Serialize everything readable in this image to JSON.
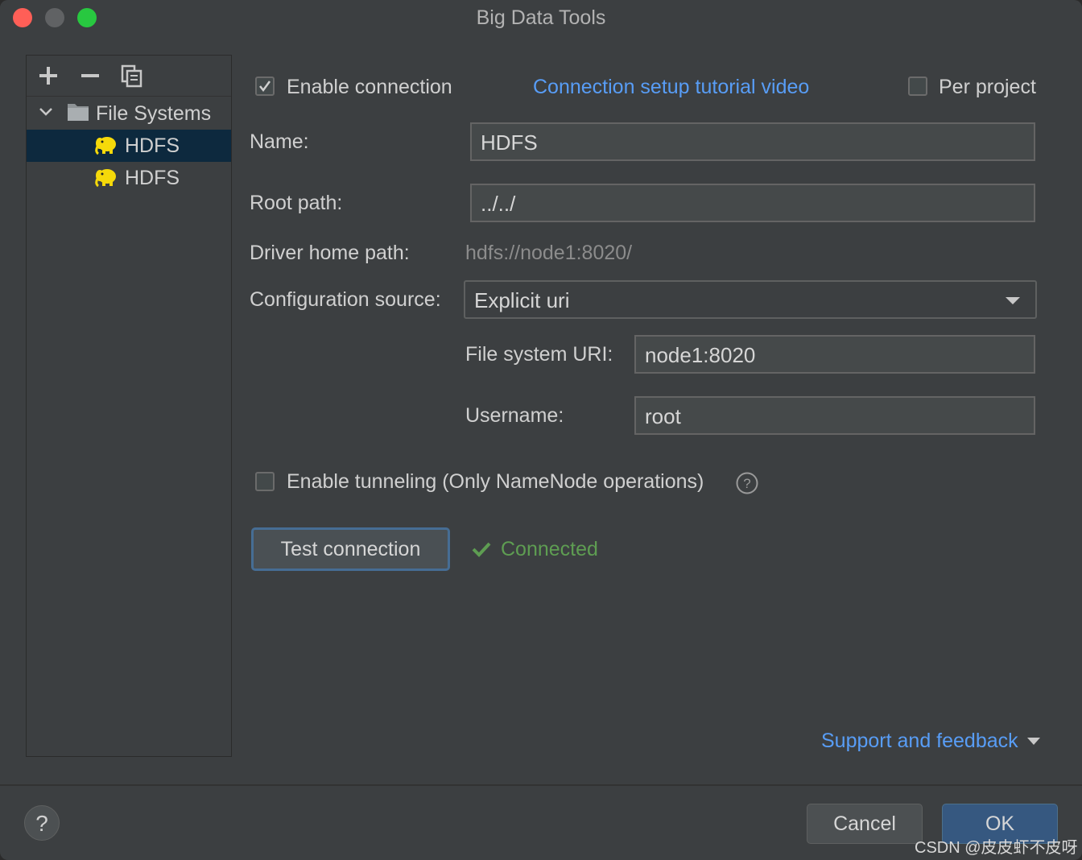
{
  "window": {
    "title": "Big Data Tools"
  },
  "sidebar": {
    "toolbar": {
      "add": "+",
      "remove": "−"
    },
    "tree": {
      "group_label": "File Systems",
      "items": [
        {
          "label": "HDFS",
          "selected": true
        },
        {
          "label": "HDFS",
          "selected": false
        }
      ]
    }
  },
  "form": {
    "enable_connection": {
      "label": "Enable connection",
      "checked": true
    },
    "tutorial_link": "Connection setup tutorial video",
    "per_project": {
      "label": "Per project",
      "checked": false
    },
    "name": {
      "label": "Name:",
      "value": "HDFS"
    },
    "root_path": {
      "label": "Root path:",
      "value": "../../"
    },
    "driver_home": {
      "label": "Driver home path:",
      "value": "hdfs://node1:8020/"
    },
    "config_source": {
      "label": "Configuration source:",
      "value": "Explicit uri"
    },
    "fs_uri": {
      "label": "File system URI:",
      "value": "node1:8020"
    },
    "username": {
      "label": "Username:",
      "value": "root"
    },
    "tunneling": {
      "label": "Enable tunneling (Only NameNode operations)",
      "checked": false
    },
    "test_button": "Test connection",
    "status": "Connected",
    "support_link": "Support and feedback"
  },
  "footer": {
    "help": "?",
    "cancel": "Cancel",
    "ok": "OK"
  },
  "watermark": "CSDN @皮皮虾不皮呀",
  "colors": {
    "background": "#3c3f41",
    "link": "#589df6",
    "success": "#5e9d52",
    "selection": "#0d293e",
    "primary_button": "#365880"
  }
}
